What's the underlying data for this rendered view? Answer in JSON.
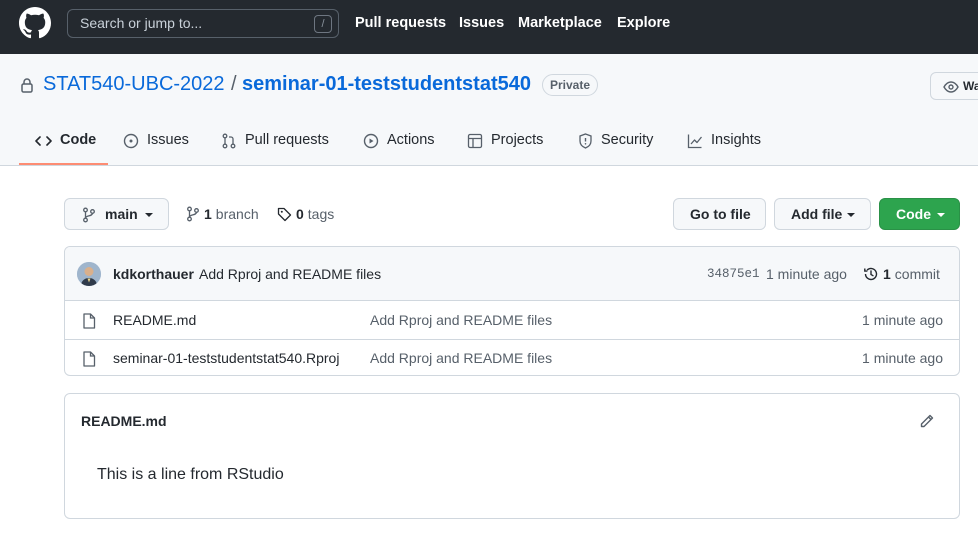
{
  "header": {
    "search_placeholder": "Search or jump to...",
    "search_shortcut": "/",
    "nav": [
      "Pull requests",
      "Issues",
      "Marketplace",
      "Explore"
    ]
  },
  "repo": {
    "owner": "STAT540-UBC-2022",
    "separator": "/",
    "name": "seminar-01-teststudentstat540",
    "visibility": "Private",
    "watch_label": "Wa"
  },
  "tabs": [
    {
      "label": "Code",
      "icon": "code-icon",
      "active": true
    },
    {
      "label": "Issues",
      "icon": "issue-icon"
    },
    {
      "label": "Pull requests",
      "icon": "pull-request-icon"
    },
    {
      "label": "Actions",
      "icon": "play-icon"
    },
    {
      "label": "Projects",
      "icon": "table-icon"
    },
    {
      "label": "Security",
      "icon": "shield-icon"
    },
    {
      "label": "Insights",
      "icon": "graph-icon"
    }
  ],
  "filenav": {
    "branch_button": "main",
    "branch_count": "1",
    "branch_word": "branch",
    "tag_count": "0",
    "tag_word": "tags",
    "go_to_file": "Go to file",
    "add_file": "Add file",
    "code_button": "Code"
  },
  "latest_commit": {
    "author": "kdkorthauer",
    "message": "Add Rproj and README files",
    "sha": "34875e1",
    "time": "1 minute ago",
    "commit_count": "1",
    "commit_word": "commit"
  },
  "files": [
    {
      "name": "README.md",
      "message": "Add Rproj and README files",
      "time": "1 minute ago"
    },
    {
      "name": "seminar-01-teststudentstat540.Rproj",
      "message": "Add Rproj and README files",
      "time": "1 minute ago"
    }
  ],
  "readme": {
    "title": "README.md",
    "body": "This is a line from RStudio"
  },
  "colors": {
    "header_bg": "#24292f",
    "link": "#0969da",
    "code_button": "#2da44e",
    "active_tab_underline": "#fd8c73"
  }
}
